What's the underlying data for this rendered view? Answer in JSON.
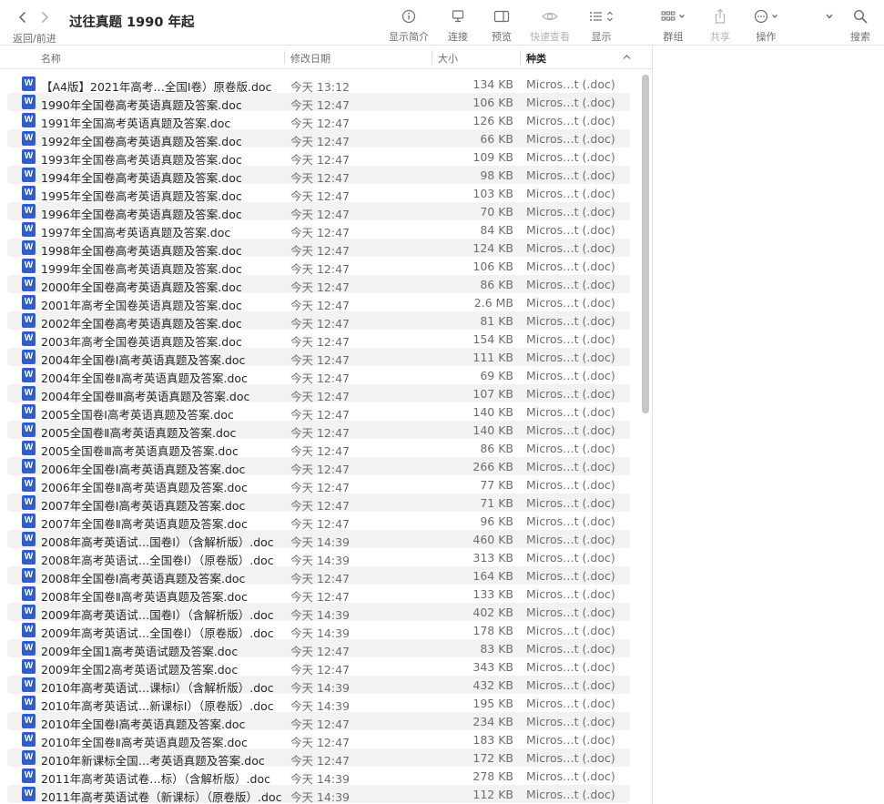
{
  "toolbar": {
    "title": "过往真题 1990 年起",
    "nav_label": "返回/前进",
    "buttons": {
      "info": "显示简介",
      "connect": "连接",
      "preview": "预览",
      "quicklook": "快速查看",
      "view": "显示",
      "group": "群组",
      "share": "共享",
      "action": "操作",
      "search": "搜索"
    }
  },
  "columns": {
    "name": "名称",
    "date": "修改日期",
    "size": "大小",
    "kind": "种类"
  },
  "file_icon_letter": "W",
  "files": [
    {
      "name": "【A4版】2021年高考…全国Ⅰ卷）原卷版.doc",
      "date": "今天 13:12",
      "size": "134 KB",
      "kind": "Micros…t (.doc)"
    },
    {
      "name": "1990年全国卷高考英语真题及答案.doc",
      "date": "今天 12:47",
      "size": "106 KB",
      "kind": "Micros…t (.doc)"
    },
    {
      "name": "1991年全国高考英语真题及答案.doc",
      "date": "今天 12:47",
      "size": "126 KB",
      "kind": "Micros…t (.doc)"
    },
    {
      "name": "1992年全国卷高考英语真题及答案.doc",
      "date": "今天 12:47",
      "size": "66 KB",
      "kind": "Micros…t (.doc)"
    },
    {
      "name": "1993年全国卷高考英语真题及答案.doc",
      "date": "今天 12:47",
      "size": "109 KB",
      "kind": "Micros…t (.doc)"
    },
    {
      "name": "1994年全国卷高考英语真题及答案.doc",
      "date": "今天 12:47",
      "size": "98 KB",
      "kind": "Micros…t (.doc)"
    },
    {
      "name": "1995年全国卷高考英语真题及答案.doc",
      "date": "今天 12:47",
      "size": "103 KB",
      "kind": "Micros…t (.doc)"
    },
    {
      "name": "1996年全国卷高考英语真题及答案.doc",
      "date": "今天 12:47",
      "size": "70 KB",
      "kind": "Micros…t (.doc)"
    },
    {
      "name": "1997年全国高考英语真题及答案.doc",
      "date": "今天 12:47",
      "size": "84 KB",
      "kind": "Micros…t (.doc)"
    },
    {
      "name": "1998年全国卷高考英语真题及答案.doc",
      "date": "今天 12:47",
      "size": "124 KB",
      "kind": "Micros…t (.doc)"
    },
    {
      "name": "1999年全国卷高考英语真题及答案.doc",
      "date": "今天 12:47",
      "size": "106 KB",
      "kind": "Micros…t (.doc)"
    },
    {
      "name": "2000年全国卷高考英语真题及答案.doc",
      "date": "今天 12:47",
      "size": "86 KB",
      "kind": "Micros…t (.doc)"
    },
    {
      "name": "2001年高考全国卷英语真题及答案.doc",
      "date": "今天 12:47",
      "size": "2.6 MB",
      "kind": "Micros…t (.doc)"
    },
    {
      "name": "2002年全国卷高考英语真题及答案.doc",
      "date": "今天 12:47",
      "size": "81 KB",
      "kind": "Micros…t (.doc)"
    },
    {
      "name": "2003年高考全国卷英语真题及答案.doc",
      "date": "今天 12:47",
      "size": "154 KB",
      "kind": "Micros…t (.doc)"
    },
    {
      "name": "2004年全国卷Ⅰ高考英语真题及答案.doc",
      "date": "今天 12:47",
      "size": "111 KB",
      "kind": "Micros…t (.doc)"
    },
    {
      "name": "2004年全国卷Ⅱ高考英语真题及答案.doc",
      "date": "今天 12:47",
      "size": "69 KB",
      "kind": "Micros…t (.doc)"
    },
    {
      "name": "2004年全国卷Ⅲ高考英语真题及答案.doc",
      "date": "今天 12:47",
      "size": "107 KB",
      "kind": "Micros…t (.doc)"
    },
    {
      "name": "2005全国卷Ⅰ高考英语真题及答案.doc",
      "date": "今天 12:47",
      "size": "140 KB",
      "kind": "Micros…t (.doc)"
    },
    {
      "name": "2005全国卷Ⅱ高考英语真题及答案.doc",
      "date": "今天 12:47",
      "size": "140 KB",
      "kind": "Micros…t (.doc)"
    },
    {
      "name": "2005全国卷Ⅲ高考英语真题及答案.doc",
      "date": "今天 12:47",
      "size": "86 KB",
      "kind": "Micros…t (.doc)"
    },
    {
      "name": "2006年全国卷Ⅰ高考英语真题及答案.doc",
      "date": "今天 12:47",
      "size": "266 KB",
      "kind": "Micros…t (.doc)"
    },
    {
      "name": "2006年全国卷Ⅱ高考英语真题及答案.doc",
      "date": "今天 12:47",
      "size": "77 KB",
      "kind": "Micros…t (.doc)"
    },
    {
      "name": "2007年全国卷Ⅰ高考英语真题及答案.doc",
      "date": "今天 12:47",
      "size": "71 KB",
      "kind": "Micros…t (.doc)"
    },
    {
      "name": "2007年全国卷Ⅱ高考英语真题及答案.doc",
      "date": "今天 12:47",
      "size": "96 KB",
      "kind": "Micros…t (.doc)"
    },
    {
      "name": "2008年高考英语试…国卷Ⅰ）（含解析版）.doc",
      "date": "今天 14:39",
      "size": "460 KB",
      "kind": "Micros…t (.doc)"
    },
    {
      "name": "2008年高考英语试…全国卷Ⅰ）（原卷版）.doc",
      "date": "今天 14:39",
      "size": "313 KB",
      "kind": "Micros…t (.doc)"
    },
    {
      "name": "2008年全国卷Ⅰ高考英语真题及答案.doc",
      "date": "今天 12:47",
      "size": "164 KB",
      "kind": "Micros…t (.doc)"
    },
    {
      "name": "2008年全国卷Ⅱ高考英语真题及答案.doc",
      "date": "今天 12:47",
      "size": "133 KB",
      "kind": "Micros…t (.doc)"
    },
    {
      "name": "2009年高考英语试…国卷Ⅰ）（含解析版）.doc",
      "date": "今天 14:39",
      "size": "402 KB",
      "kind": "Micros…t (.doc)"
    },
    {
      "name": "2009年高考英语试…全国卷Ⅰ）（原卷版）.doc",
      "date": "今天 14:39",
      "size": "178 KB",
      "kind": "Micros…t (.doc)"
    },
    {
      "name": "2009年全国1高考英语试题及答案.doc",
      "date": "今天 12:47",
      "size": "83 KB",
      "kind": "Micros…t (.doc)"
    },
    {
      "name": "2009年全国2高考英语试题及答案.doc",
      "date": "今天 12:47",
      "size": "343 KB",
      "kind": "Micros…t (.doc)"
    },
    {
      "name": "2010年高考英语试…课标Ⅰ）（含解析版）.doc",
      "date": "今天 14:39",
      "size": "432 KB",
      "kind": "Micros…t (.doc)"
    },
    {
      "name": "2010年高考英语试…新课标Ⅰ）（原卷版）.doc",
      "date": "今天 14:39",
      "size": "195 KB",
      "kind": "Micros…t (.doc)"
    },
    {
      "name": "2010年全国卷Ⅰ高考英语真题及答案.doc",
      "date": "今天 12:47",
      "size": "234 KB",
      "kind": "Micros…t (.doc)"
    },
    {
      "name": "2010年全国卷Ⅱ高考英语真题及答案.doc",
      "date": "今天 12:47",
      "size": "183 KB",
      "kind": "Micros…t (.doc)"
    },
    {
      "name": "2010年新课标全国…考英语真题及答案.doc",
      "date": "今天 12:47",
      "size": "172 KB",
      "kind": "Micros…t (.doc)"
    },
    {
      "name": "2011年高考英语试卷…标）（含解析版）.doc",
      "date": "今天 14:39",
      "size": "278 KB",
      "kind": "Micros…t (.doc)"
    },
    {
      "name": "2011年高考英语试卷（新课标）（原卷版）.doc",
      "date": "今天 14:39",
      "size": "112 KB",
      "kind": "Micros…t (.doc)"
    }
  ]
}
